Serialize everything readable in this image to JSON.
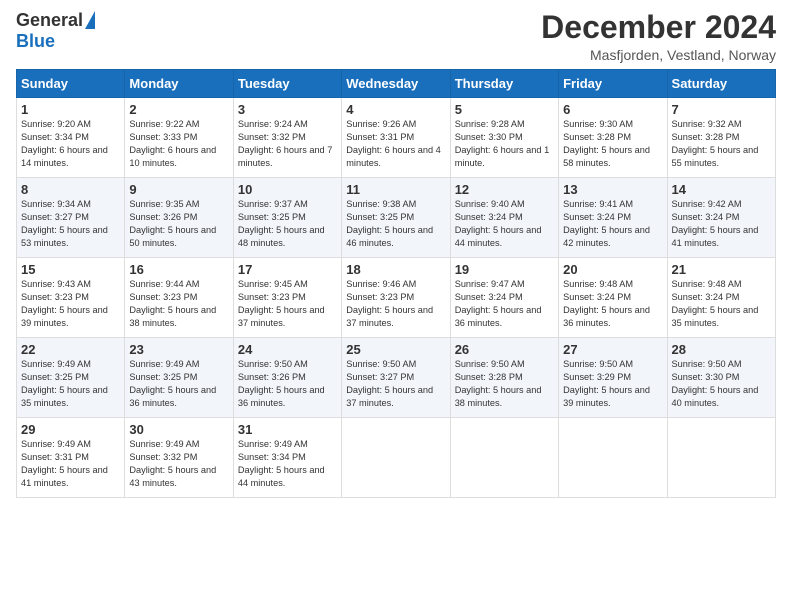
{
  "logo": {
    "general": "General",
    "blue": "Blue"
  },
  "header": {
    "month": "December 2024",
    "location": "Masfjorden, Vestland, Norway"
  },
  "days_of_week": [
    "Sunday",
    "Monday",
    "Tuesday",
    "Wednesday",
    "Thursday",
    "Friday",
    "Saturday"
  ],
  "weeks": [
    [
      {
        "day": "1",
        "sunrise": "9:20 AM",
        "sunset": "3:34 PM",
        "daylight": "6 hours and 14 minutes."
      },
      {
        "day": "2",
        "sunrise": "9:22 AM",
        "sunset": "3:33 PM",
        "daylight": "6 hours and 10 minutes."
      },
      {
        "day": "3",
        "sunrise": "9:24 AM",
        "sunset": "3:32 PM",
        "daylight": "6 hours and 7 minutes."
      },
      {
        "day": "4",
        "sunrise": "9:26 AM",
        "sunset": "3:31 PM",
        "daylight": "6 hours and 4 minutes."
      },
      {
        "day": "5",
        "sunrise": "9:28 AM",
        "sunset": "3:30 PM",
        "daylight": "6 hours and 1 minute."
      },
      {
        "day": "6",
        "sunrise": "9:30 AM",
        "sunset": "3:28 PM",
        "daylight": "5 hours and 58 minutes."
      },
      {
        "day": "7",
        "sunrise": "9:32 AM",
        "sunset": "3:28 PM",
        "daylight": "5 hours and 55 minutes."
      }
    ],
    [
      {
        "day": "8",
        "sunrise": "9:34 AM",
        "sunset": "3:27 PM",
        "daylight": "5 hours and 53 minutes."
      },
      {
        "day": "9",
        "sunrise": "9:35 AM",
        "sunset": "3:26 PM",
        "daylight": "5 hours and 50 minutes."
      },
      {
        "day": "10",
        "sunrise": "9:37 AM",
        "sunset": "3:25 PM",
        "daylight": "5 hours and 48 minutes."
      },
      {
        "day": "11",
        "sunrise": "9:38 AM",
        "sunset": "3:25 PM",
        "daylight": "5 hours and 46 minutes."
      },
      {
        "day": "12",
        "sunrise": "9:40 AM",
        "sunset": "3:24 PM",
        "daylight": "5 hours and 44 minutes."
      },
      {
        "day": "13",
        "sunrise": "9:41 AM",
        "sunset": "3:24 PM",
        "daylight": "5 hours and 42 minutes."
      },
      {
        "day": "14",
        "sunrise": "9:42 AM",
        "sunset": "3:24 PM",
        "daylight": "5 hours and 41 minutes."
      }
    ],
    [
      {
        "day": "15",
        "sunrise": "9:43 AM",
        "sunset": "3:23 PM",
        "daylight": "5 hours and 39 minutes."
      },
      {
        "day": "16",
        "sunrise": "9:44 AM",
        "sunset": "3:23 PM",
        "daylight": "5 hours and 38 minutes."
      },
      {
        "day": "17",
        "sunrise": "9:45 AM",
        "sunset": "3:23 PM",
        "daylight": "5 hours and 37 minutes."
      },
      {
        "day": "18",
        "sunrise": "9:46 AM",
        "sunset": "3:23 PM",
        "daylight": "5 hours and 37 minutes."
      },
      {
        "day": "19",
        "sunrise": "9:47 AM",
        "sunset": "3:24 PM",
        "daylight": "5 hours and 36 minutes."
      },
      {
        "day": "20",
        "sunrise": "9:48 AM",
        "sunset": "3:24 PM",
        "daylight": "5 hours and 36 minutes."
      },
      {
        "day": "21",
        "sunrise": "9:48 AM",
        "sunset": "3:24 PM",
        "daylight": "5 hours and 35 minutes."
      }
    ],
    [
      {
        "day": "22",
        "sunrise": "9:49 AM",
        "sunset": "3:25 PM",
        "daylight": "5 hours and 35 minutes."
      },
      {
        "day": "23",
        "sunrise": "9:49 AM",
        "sunset": "3:25 PM",
        "daylight": "5 hours and 36 minutes."
      },
      {
        "day": "24",
        "sunrise": "9:50 AM",
        "sunset": "3:26 PM",
        "daylight": "5 hours and 36 minutes."
      },
      {
        "day": "25",
        "sunrise": "9:50 AM",
        "sunset": "3:27 PM",
        "daylight": "5 hours and 37 minutes."
      },
      {
        "day": "26",
        "sunrise": "9:50 AM",
        "sunset": "3:28 PM",
        "daylight": "5 hours and 38 minutes."
      },
      {
        "day": "27",
        "sunrise": "9:50 AM",
        "sunset": "3:29 PM",
        "daylight": "5 hours and 39 minutes."
      },
      {
        "day": "28",
        "sunrise": "9:50 AM",
        "sunset": "3:30 PM",
        "daylight": "5 hours and 40 minutes."
      }
    ],
    [
      {
        "day": "29",
        "sunrise": "9:49 AM",
        "sunset": "3:31 PM",
        "daylight": "5 hours and 41 minutes."
      },
      {
        "day": "30",
        "sunrise": "9:49 AM",
        "sunset": "3:32 PM",
        "daylight": "5 hours and 43 minutes."
      },
      {
        "day": "31",
        "sunrise": "9:49 AM",
        "sunset": "3:34 PM",
        "daylight": "5 hours and 44 minutes."
      },
      null,
      null,
      null,
      null
    ]
  ]
}
